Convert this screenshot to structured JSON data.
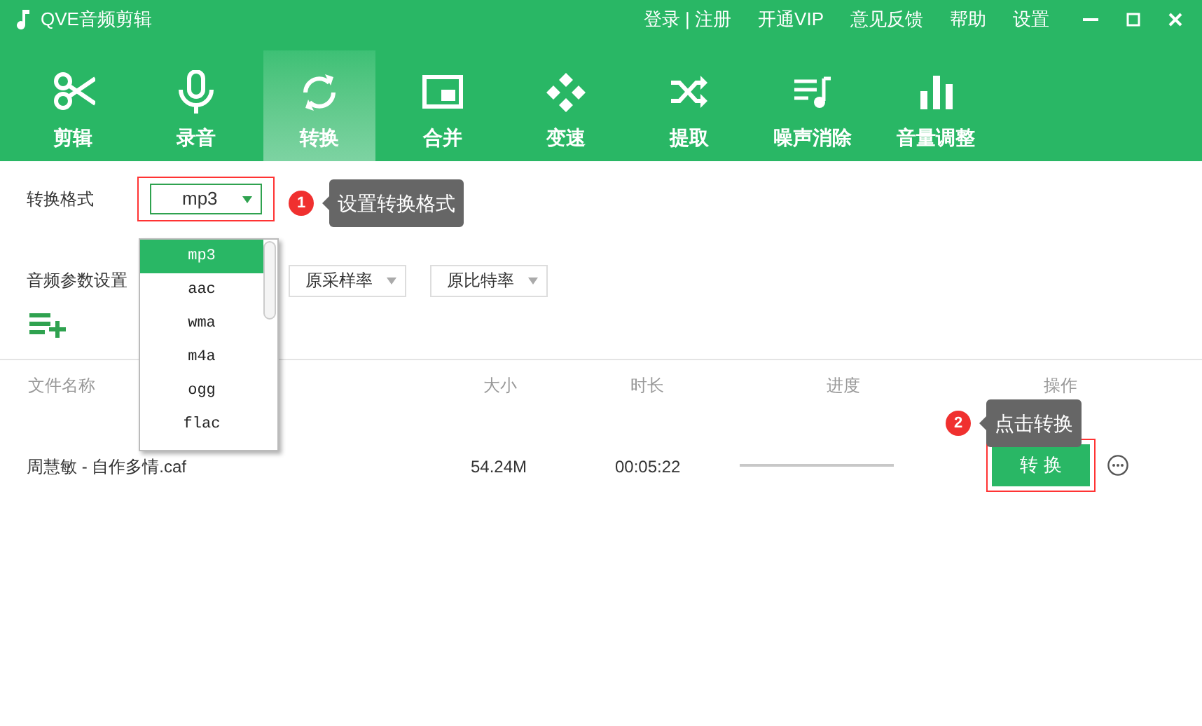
{
  "window": {
    "title": "QVE音频剪辑"
  },
  "top_links": [
    "登录 | 注册",
    "开通VIP",
    "意见反馈",
    "帮助",
    "设置"
  ],
  "tabs": [
    {
      "label": "剪辑",
      "kind": "scissors",
      "selected": false
    },
    {
      "label": "录音",
      "kind": "mic",
      "selected": false
    },
    {
      "label": "转换",
      "kind": "convert",
      "selected": true
    },
    {
      "label": "合并",
      "kind": "merge",
      "selected": false
    },
    {
      "label": "变速",
      "kind": "speed",
      "selected": false
    },
    {
      "label": "提取",
      "kind": "shuffle",
      "selected": false
    },
    {
      "label": "噪声消除",
      "kind": "noise",
      "selected": false
    },
    {
      "label": "音量调整",
      "kind": "volume",
      "selected": false
    }
  ],
  "format": {
    "label": "转换格式",
    "value": "mp3",
    "expanded": true,
    "options": [
      {
        "label": "mp3",
        "selected": true
      },
      {
        "label": "aac",
        "selected": false
      },
      {
        "label": "wma",
        "selected": false
      },
      {
        "label": "m4a",
        "selected": false
      },
      {
        "label": "ogg",
        "selected": false
      },
      {
        "label": "flac",
        "selected": false
      }
    ]
  },
  "audio_params": {
    "label": "音频参数设置",
    "selects": [
      "原采样率",
      "原比特率"
    ]
  },
  "callouts": [
    {
      "number": "1",
      "text": "设置转换格式"
    },
    {
      "number": "2",
      "text": "点击转换"
    }
  ],
  "table": {
    "columns": [
      "文件名称",
      "大小",
      "时长",
      "进度",
      "操作"
    ],
    "rows": [
      {
        "name": "周慧敏 - 自作多情.caf",
        "size": "54.24M",
        "duration": "00:05:22",
        "level": 0,
        "action": "转 换"
      }
    ]
  }
}
